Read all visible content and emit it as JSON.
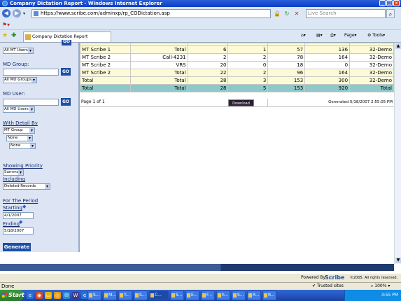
{
  "window": {
    "title": "Company Dictation Report - Windows Internet Explorer"
  },
  "browser": {
    "url": "https://www.scribe.com/adminxp/rp_CODictation.asp",
    "search_placeholder": "Live Search",
    "tab_title": "Company Dictation Report",
    "page_menu": "Page",
    "tools_menu": "Tools"
  },
  "sidebar": {
    "mt_users_select": "All MT Users",
    "md_group_label": "MD Group:",
    "md_group_value": "",
    "go_label": "GO",
    "md_groups_select": "All MD Groups",
    "md_user_label": "MD User:",
    "md_user_value": "",
    "md_users_select": "All MD Users",
    "with_detail_label": "With Detail By",
    "detail_1": "MT Group",
    "detail_2": "None",
    "detail_3": "None",
    "showing_priority_label": "Showing Priority",
    "priority_select": "Summary",
    "including_label": "Including",
    "including_select": "Deleted Records",
    "for_period_label": "For The Period",
    "starting_label": "Starting",
    "starting_value": "4/1/2007",
    "ending_label": "Ending",
    "ending_value": "5/18/2007",
    "generate_label": "Generate"
  },
  "report": {
    "rows": [
      {
        "style": "yellow",
        "c1": "MT Scribe 1",
        "c2": "Total",
        "c3": "6",
        "c4": "1",
        "c5": "57",
        "c6": "136",
        "c7": "32-Demo"
      },
      {
        "style": "white",
        "c1": "MT Scribe 2",
        "c2": "Call-4231",
        "c3": "2",
        "c4": "2",
        "c5": "78",
        "c6": "164",
        "c7": "32-Demo"
      },
      {
        "style": "white",
        "c1": "MT Scribe 2",
        "c2": "VRS",
        "c3": "20",
        "c4": "0",
        "c5": "18",
        "c6": "0",
        "c7": "32-Demo"
      },
      {
        "style": "yellow",
        "c1": "MT Scribe 2",
        "c2": "Total",
        "c3": "22",
        "c4": "2",
        "c5": "96",
        "c6": "164",
        "c7": "32-Demo"
      },
      {
        "style": "yellow",
        "c1": "Total",
        "c2": "Total",
        "c3": "28",
        "c4": "3",
        "c5": "153",
        "c6": "300",
        "c7": "32-Demo"
      },
      {
        "style": "teal",
        "c1": "Total",
        "c2": "Total",
        "c3": "28",
        "c4": "5",
        "c5": "153",
        "c6": "920",
        "c7": "Total"
      }
    ],
    "page_info": "Page 1 of 1",
    "download_label": "Download",
    "generated": "Generated 5/18/2007 2:55:05 PM"
  },
  "footer": {
    "powered_by": "Powered By",
    "logo": "Scribe",
    "copyright": "©2005. All rights reserved."
  },
  "status": {
    "text": "Done",
    "zone": "Trusted sites",
    "zoom": "100%"
  },
  "taskbar": {
    "start": "Start",
    "tasks": [
      "S...",
      "M...",
      "Y...",
      "S...",
      "C...",
      "S...",
      "E...",
      "F...",
      "h...",
      "S...",
      "R...",
      "R..."
    ],
    "clock": "3:55 PM"
  }
}
